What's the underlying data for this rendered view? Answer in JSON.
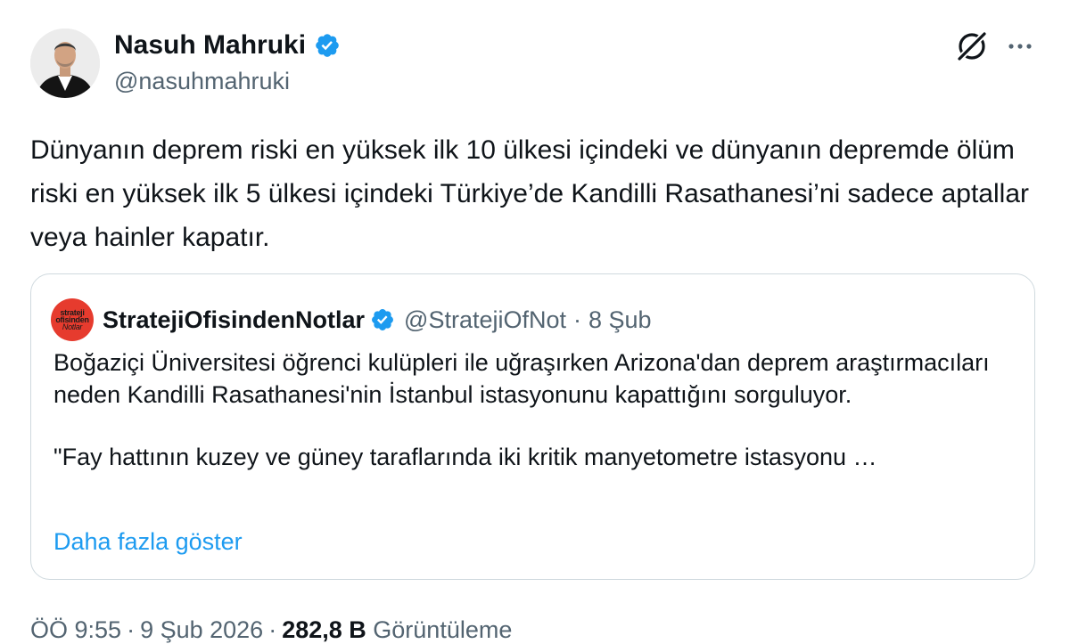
{
  "author": {
    "name": "Nasuh Mahruki",
    "handle": "@nasuhmahruki"
  },
  "tweet": {
    "text": "Dünyanın deprem riski en yüksek ilk 10 ülkesi içindeki ve dünyanın depremde ölüm riski en yüksek ilk 5 ülkesi içindeki Türkiye’de Kandilli Rasathanesi’ni sadece aptallar veya hainler kapatır."
  },
  "quote": {
    "avatar_text": [
      "strateji",
      "ofisinden",
      "Notlar"
    ],
    "name": "StratejiOfisindenNotlar",
    "handle": "@StratejiOfNot",
    "separator": "·",
    "date": "8 Şub",
    "paragraph1": "Boğaziçi Üniversitesi öğrenci kulüpleri ile uğraşırken Arizona'dan deprem araştırmacıları neden Kandilli Rasathanesi'nin İstanbul istasyonunu kapattığını sorguluyor.",
    "paragraph2": "\"Fay hattının kuzey ve güney taraflarında iki kritik manyetometre istasyonu …",
    "show_more": "Daha fazla göster"
  },
  "meta": {
    "time": "ÖÖ 9:55",
    "sep1": "·",
    "date": "9 Şub 2026",
    "sep2": "·",
    "views_count": "282,8 B",
    "views_label": "Görüntüleme"
  },
  "colors": {
    "text": "#0f1419",
    "secondary": "#536471",
    "link": "#1d9bf0",
    "verified": "#1d9bf0",
    "border": "#cfd9de",
    "quote_avatar_bg": "#e63b2e"
  },
  "icons": {
    "verified": "verified-badge-icon",
    "grok": "grok-icon",
    "more": "more-options-icon"
  }
}
